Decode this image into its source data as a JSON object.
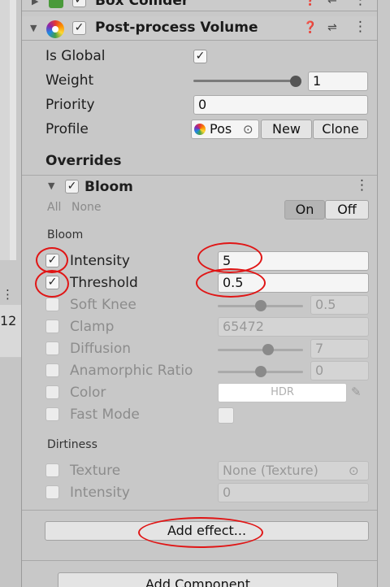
{
  "top_component": {
    "title": "Box Collider"
  },
  "component": {
    "title": "Post-process Volume",
    "is_global_label": "Is Global",
    "weight_label": "Weight",
    "weight_value": "1",
    "weight_fraction": 1.0,
    "priority_label": "Priority",
    "priority_value": "0",
    "profile_label": "Profile",
    "profile_value": "Pos",
    "new_label": "New",
    "clone_label": "Clone",
    "overrides_label": "Overrides"
  },
  "bloom": {
    "title": "Bloom",
    "all_label": "All",
    "none_label": "None",
    "on_label": "On",
    "off_label": "Off",
    "section_bloom": "Bloom",
    "intensity_label": "Intensity",
    "intensity_value": "5",
    "threshold_label": "Threshold",
    "threshold_value": "0.5",
    "soft_knee_label": "Soft Knee",
    "soft_knee_value": "0.5",
    "soft_knee_fraction": 0.5,
    "clamp_label": "Clamp",
    "clamp_value": "65472",
    "diffusion_label": "Diffusion",
    "diffusion_value": "7",
    "diffusion_fraction": 0.6,
    "anamorphic_label": "Anamorphic Ratio",
    "anamorphic_value": "0",
    "anamorphic_fraction": 0.5,
    "color_label": "Color",
    "color_value": "HDR",
    "fast_mode_label": "Fast Mode",
    "section_dirtiness": "Dirtiness",
    "texture_label": "Texture",
    "texture_value": "None (Texture)",
    "dirt_intensity_label": "Intensity",
    "dirt_intensity_value": "0"
  },
  "add_effect_label": "Add effect...",
  "add_component_label": "Add Component",
  "left_strip": {
    "number": "12"
  },
  "colors": {
    "annotation": "#e01515"
  }
}
